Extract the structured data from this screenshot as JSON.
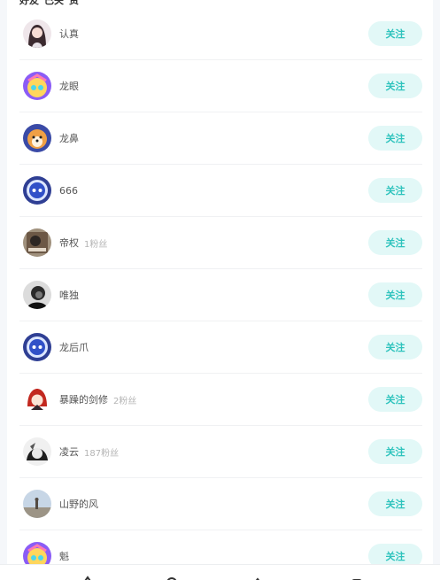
{
  "top_strip": {
    "left_text": "好友",
    "middle_text": "已关",
    "right_text": "资"
  },
  "follow_label": "关注",
  "users": [
    {
      "name": "认真",
      "fans": "",
      "avatar": "girl-avatar"
    },
    {
      "name": "龙眼",
      "fans": "",
      "avatar": "anime-avatar"
    },
    {
      "name": "龙鼻",
      "fans": "",
      "avatar": "shiba-avatar"
    },
    {
      "name": "666",
      "fans": "",
      "avatar": "robot-avatar"
    },
    {
      "name": "帝权",
      "fans": "1粉丝",
      "avatar": "photo-avatar"
    },
    {
      "name": "唯独",
      "fans": "",
      "avatar": "man-avatar"
    },
    {
      "name": "龙后爪",
      "fans": "",
      "avatar": "robot-avatar"
    },
    {
      "name": "暴躁的剑修",
      "fans": "2粉丝",
      "avatar": "red-hair-avatar"
    },
    {
      "name": "凌云",
      "fans": "187粉丝",
      "avatar": "bw-anime-avatar"
    },
    {
      "name": "山野的风",
      "fans": "",
      "avatar": "landscape-avatar"
    },
    {
      "name": "魁",
      "fans": "",
      "avatar": "anime-avatar"
    }
  ],
  "colors": {
    "follow_bg": "#e2f8f7",
    "follow_text": "#2ec3bd",
    "name_text": "#555555",
    "fans_text": "#b4b4b4"
  }
}
